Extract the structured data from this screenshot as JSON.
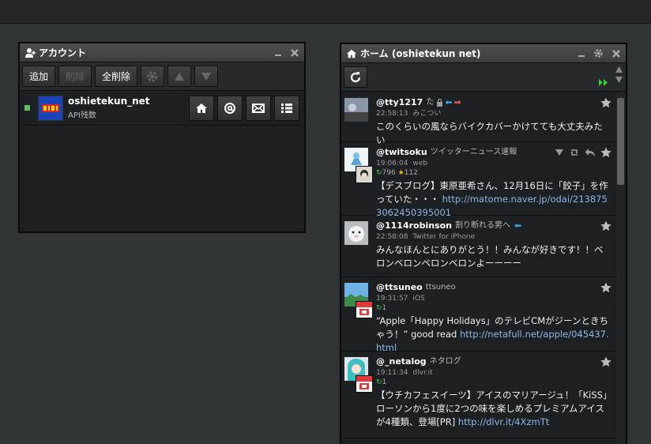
{
  "account_panel": {
    "title": "アカウント",
    "toolbar": {
      "add_label": "追加",
      "delete_label": "削除",
      "delete_all_label": "全削除"
    },
    "account": {
      "name": "oshietekun_net",
      "sub": "API残数"
    }
  },
  "home_panel": {
    "title": "ホーム (oshietekun net)"
  },
  "tweets": [
    {
      "user": "@tty1217",
      "display": "た",
      "time": "22:58:13",
      "source": "みこつい",
      "text": "このくらいの風ならバイクカバーかけてても大丈夫みたい",
      "link": ""
    },
    {
      "user": "@twitsoku",
      "display": "ツイッターニュース速報",
      "time": "19:06:04",
      "source": "web",
      "rt_count": "796",
      "fav_count": "112",
      "text": "【デスブログ】東原亜希さん、12月16日に「餃子」を作っていた・・・",
      "link": "http://matome.naver.jp/odai/2138753062450395001"
    },
    {
      "user": "@1114robinson",
      "display": "割り断れる男へ",
      "time": "22:58:08",
      "source": "Twitter for iPhone",
      "text": "みんなほんとにありがとう！！みんなが好きです！！ベロンベロンベロンベロンよーーーー",
      "link": ""
    },
    {
      "user": "@ttsuneo",
      "display": "ttsuneo",
      "time": "19:31:57",
      "source": "iOS",
      "rt_count": "1",
      "text": "“Apple「Happy Holidays」のテレビCMがジーンときちゃう！” good read",
      "link": "http://netafull.net/apple/045437.html"
    },
    {
      "user": "@_netalog",
      "display": "ネタログ",
      "time": "19:11:34",
      "source": "dlvr.it",
      "rt_count": "1",
      "text": "【ウチカフェスイーツ】アイスのマリアージュ！「KiSS」ローソンから1度に2つの味を楽しめるプレミアムアイスが4種類、登場[PR]",
      "link": "http://dlvr.it/4XzmTt"
    }
  ]
}
